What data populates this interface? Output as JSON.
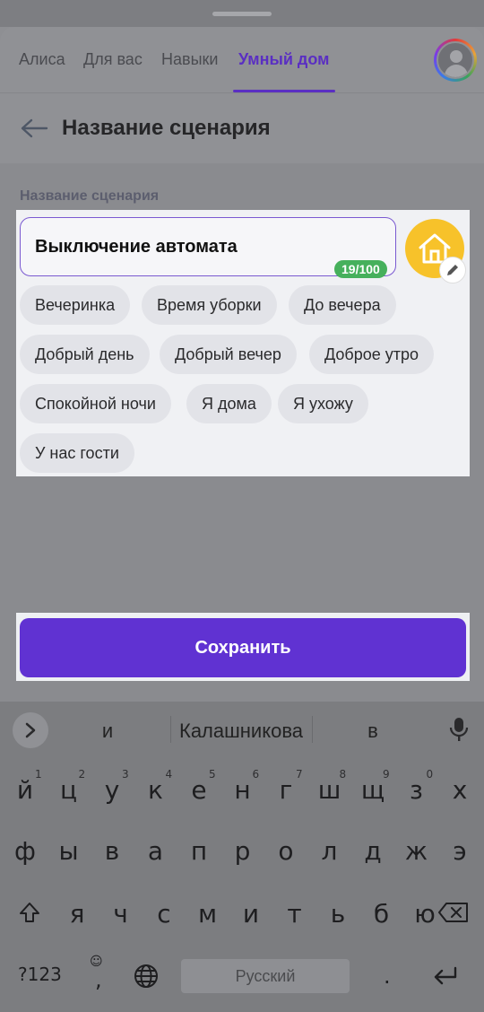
{
  "nav": {
    "tabs": [
      {
        "label": "Алиса"
      },
      {
        "label": "Для вас"
      },
      {
        "label": "Навыки"
      },
      {
        "label": "Умный дом"
      }
    ],
    "active_tab": "Умный дом"
  },
  "header": {
    "title": "Название сценария"
  },
  "form": {
    "field_label": "Название сценария",
    "name_value": "Выключение автомата",
    "counter": "19/100",
    "icon": "home-icon",
    "icon_color": "#f7c22a"
  },
  "suggestions": {
    "chips": [
      "Вечеринка",
      "Время уборки",
      "До вечера",
      "Добрый день",
      "Добрый вечер",
      "Доброе утро",
      "Спокойной ночи",
      "Я дома",
      "Я ухожу",
      "У нас гости"
    ]
  },
  "actions": {
    "save_label": "Сохранить",
    "accent": "#6032d2"
  },
  "keyboard": {
    "suggestions": [
      "и",
      "Калашникова",
      "в"
    ],
    "row1": [
      "й",
      "ц",
      "у",
      "к",
      "е",
      "н",
      "г",
      "ш",
      "щ",
      "з",
      "х"
    ],
    "row1_hints": [
      "1",
      "2",
      "3",
      "4",
      "5",
      "6",
      "7",
      "8",
      "9",
      "0"
    ],
    "row2": [
      "ф",
      "ы",
      "в",
      "а",
      "п",
      "р",
      "о",
      "л",
      "д",
      "ж",
      "э"
    ],
    "row3": [
      "я",
      "ч",
      "с",
      "м",
      "и",
      "т",
      "ь",
      "б",
      "ю"
    ],
    "mode_key": "?123",
    "comma_key": ",",
    "period_key": ".",
    "space_label": "Русский"
  }
}
